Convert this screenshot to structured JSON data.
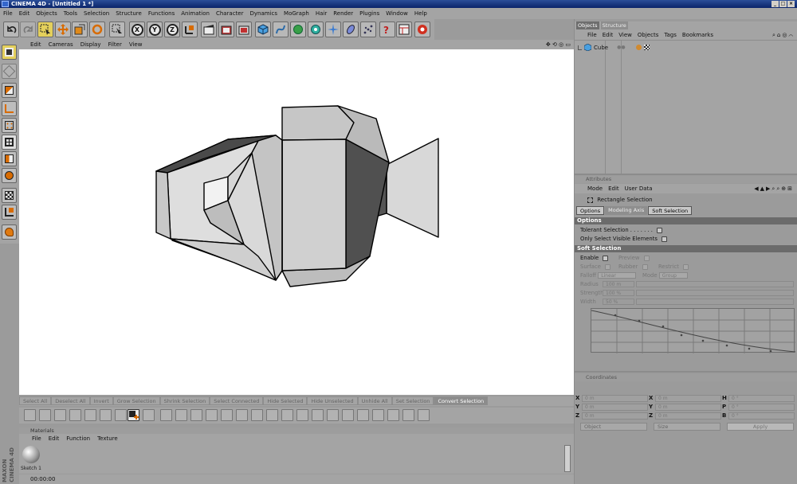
{
  "app": {
    "title": "CINEMA 4D - [Untitled 1 *]"
  },
  "menubar": [
    "File",
    "Edit",
    "Objects",
    "Tools",
    "Selection",
    "Structure",
    "Functions",
    "Animation",
    "Character",
    "Dynamics",
    "MoGraph",
    "Hair",
    "Render",
    "Plugins",
    "Window",
    "Help"
  ],
  "viewport": {
    "menu": [
      "Edit",
      "Cameras",
      "Display",
      "Filter",
      "View"
    ],
    "corner_icons": "✥ ⟲ ◎ ▭"
  },
  "selection_bar": [
    "Select All",
    "Deselect All",
    "Invert",
    "Grow Selection",
    "Shrink Selection",
    "Select Connected",
    "Hide Selected",
    "Hide Unselected",
    "Unhide All",
    "Set Selection",
    "Convert Selection"
  ],
  "toolbar": {
    "axes": [
      "X",
      "Y",
      "Z"
    ]
  },
  "materials": {
    "header": "Materials",
    "menu": [
      "File",
      "Edit",
      "Function",
      "Texture"
    ],
    "item": "Sketch 1",
    "timecode": "00:00:00"
  },
  "branding": {
    "line1": "MAXON",
    "line2": "CINEMA 4D"
  },
  "objects_panel": {
    "tabs": [
      "Objects",
      "Structure"
    ],
    "menu": [
      "File",
      "Edit",
      "View",
      "Objects",
      "Tags",
      "Bookmarks"
    ],
    "object_name": "Cube"
  },
  "attributes": {
    "header": "Attributes",
    "menu": [
      "Mode",
      "Edit",
      "User Data"
    ],
    "tool_name": "Rectangle Selection",
    "tabs": [
      "Options",
      "Modeling Axis",
      "Soft Selection"
    ],
    "options_title": "Options",
    "tolerant_selection": "Tolerant Selection . . . . . . .",
    "only_visible": "Only Select Visible Elements",
    "soft_title": "Soft Selection",
    "enable": "Enable",
    "preview": "Preview",
    "surface": "Surface",
    "rubber": "Rubber",
    "restrict": "Restrict",
    "falloff_label": "Falloff",
    "falloff_value": "Linear",
    "mode_label": "Mode",
    "mode_value": "Group",
    "radius_label": "Radius",
    "radius_value": "100 m",
    "strength_label": "Strength",
    "strength_value": "100 %",
    "width_label": "Width",
    "width_value": "50 %"
  },
  "coordinates": {
    "header": "Coordinates",
    "rows": [
      {
        "a": "X",
        "av": "0 m",
        "b": "X",
        "bv": "0 m",
        "c": "H",
        "cv": "0 °"
      },
      {
        "a": "Y",
        "av": "0 m",
        "b": "Y",
        "bv": "0 m",
        "c": "P",
        "cv": "0 °"
      },
      {
        "a": "Z",
        "av": "0 m",
        "b": "Z",
        "bv": "0 m",
        "c": "B",
        "cv": "0 °"
      }
    ],
    "mode1": "Object",
    "mode2": "Size",
    "apply": "Apply"
  },
  "colors": {
    "titlebar": "#0a246a",
    "panel": "#a4a4a4",
    "section": "#6b6b6b",
    "highlight": "#e4d05c"
  }
}
